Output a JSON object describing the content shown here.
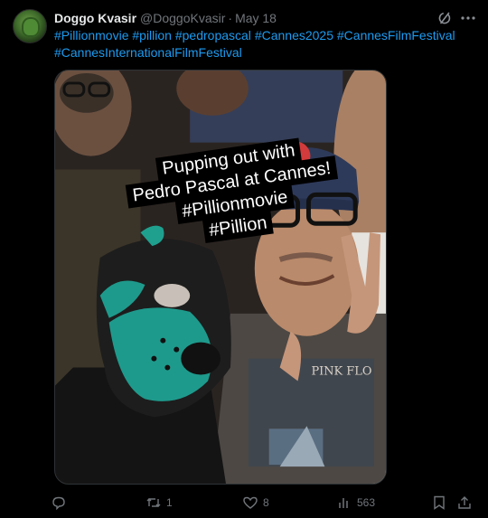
{
  "tweet": {
    "display_name": "Doggo Kvasir",
    "handle": "@DoggoKvasir",
    "separator": "·",
    "date": "May 18",
    "hashtags_line1": [
      "#Pillionmovie",
      "#pillion",
      "#pedropascal",
      "#Cannes2025",
      "#CannesFilmFestival"
    ],
    "hashtags_line2": [
      "#CannesInternationalFilmFestival"
    ]
  },
  "media": {
    "overlay_lines": [
      "Pupping out with",
      "Pedro Pascal  at Cannes!",
      "#Pillionmovie",
      "#Pillion"
    ],
    "shirt_text": "PINK FLO"
  },
  "actions": {
    "reply_count": "",
    "retweet_count": "1",
    "like_count": "8",
    "views_count": "563"
  },
  "icons": {
    "reply": "reply-icon",
    "retweet": "retweet-icon",
    "like": "like-icon",
    "views": "views-icon",
    "bookmark": "bookmark-icon",
    "share": "share-icon",
    "grok": "grok-icon",
    "more": "more-icon"
  },
  "colors": {
    "background": "#000000",
    "link": "#1d9bf0",
    "muted": "#71767b",
    "text": "#e7e9ea",
    "mask_teal": "#1e9a8c"
  }
}
